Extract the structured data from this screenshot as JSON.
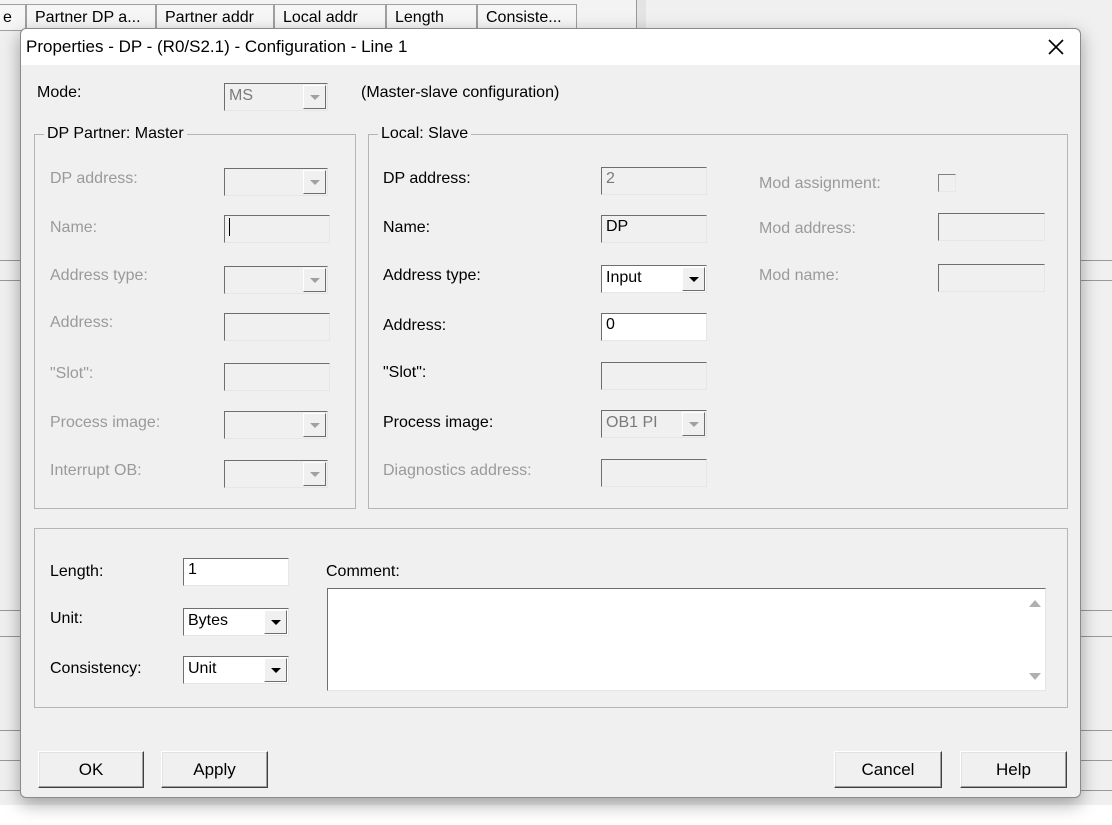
{
  "background": {
    "columns": [
      "e",
      "Partner DP a...",
      "Partner addr",
      "Local addr",
      "Length",
      "Consiste..."
    ]
  },
  "dialog": {
    "title": "Properties - DP - (R0/S2.1) - Configuration - Line 1",
    "close_icon": "close-icon",
    "mode": {
      "label": "Mode:",
      "value": "MS",
      "description": "(Master-slave configuration)"
    },
    "partner": {
      "legend": "DP Partner: Master",
      "dp_address_label": "DP address:",
      "dp_address_value": "",
      "name_label": "Name:",
      "name_value": "",
      "address_type_label": "Address type:",
      "address_type_value": "",
      "address_label": "Address:",
      "address_value": "",
      "slot_label": "\"Slot\":",
      "slot_value": "",
      "process_image_label": "Process image:",
      "process_image_value": "",
      "interrupt_ob_label": "Interrupt OB:",
      "interrupt_ob_value": ""
    },
    "local": {
      "legend": "Local: Slave",
      "dp_address_label": "DP address:",
      "dp_address_value": "2",
      "name_label": "Name:",
      "name_value": "DP",
      "address_type_label": "Address type:",
      "address_type_value": "Input",
      "address_label": "Address:",
      "address_value": "0",
      "slot_label": "\"Slot\":",
      "slot_value": "",
      "process_image_label": "Process image:",
      "process_image_value": "OB1 PI",
      "diagnostics_address_label": "Diagnostics address:",
      "diagnostics_address_value": "",
      "mod_assignment_label": "Mod assignment:",
      "mod_address_label": "Mod address:",
      "mod_address_value": "",
      "mod_name_label": "Mod name:",
      "mod_name_value": ""
    },
    "data": {
      "length_label": "Length:",
      "length_value": "1",
      "unit_label": "Unit:",
      "unit_value": "Bytes",
      "consistency_label": "Consistency:",
      "consistency_value": "Unit",
      "comment_label": "Comment:",
      "comment_value": ""
    },
    "buttons": {
      "ok": "OK",
      "apply": "Apply",
      "cancel": "Cancel",
      "help": "Help"
    }
  }
}
